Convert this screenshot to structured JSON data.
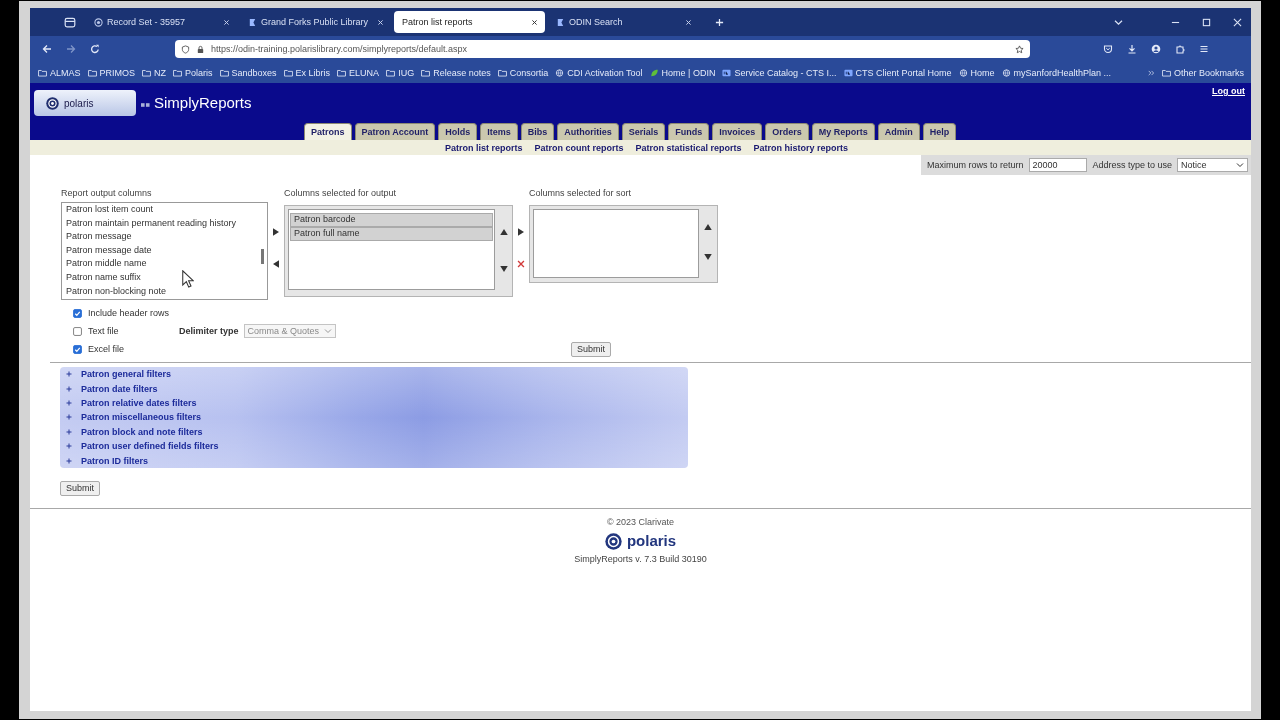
{
  "browser": {
    "tabs": [
      {
        "title": "Record Set - 35957",
        "kind": "dot",
        "selected": false
      },
      {
        "title": "Grand Forks Public Library",
        "kind": "flag",
        "selected": false
      },
      {
        "title": "Patron list reports",
        "kind": "none",
        "selected": true
      },
      {
        "title": "ODIN Search",
        "kind": "flag",
        "selected": false
      }
    ],
    "url": "https://odin-training.polarislibrary.com/simplyreports/default.aspx",
    "bookmarks": [
      {
        "label": "ALMAS",
        "kind": "folder"
      },
      {
        "label": "PRIMOS",
        "kind": "folder"
      },
      {
        "label": "NZ",
        "kind": "folder"
      },
      {
        "label": "Polaris",
        "kind": "folder"
      },
      {
        "label": "Sandboxes",
        "kind": "folder"
      },
      {
        "label": "Ex Libris",
        "kind": "folder"
      },
      {
        "label": "ELUNA",
        "kind": "folder"
      },
      {
        "label": "IUG",
        "kind": "folder"
      },
      {
        "label": "Release notes",
        "kind": "folder"
      },
      {
        "label": "Consortia",
        "kind": "folder"
      },
      {
        "label": "CDI Activation Tool",
        "kind": "globe"
      },
      {
        "label": "Home | ODIN",
        "kind": "leaf"
      },
      {
        "label": "Service Catalog - CTS I...",
        "kind": "tile"
      },
      {
        "label": "CTS Client Portal Home",
        "kind": "tile"
      },
      {
        "label": "Home",
        "kind": "globe"
      },
      {
        "label": "mySanfordHealthPlan ...",
        "kind": "globe"
      }
    ],
    "other_bookmarks": "Other Bookmarks"
  },
  "app": {
    "logo": "polaris",
    "title": "SimplyReports",
    "logout": "Log out",
    "tabs": [
      {
        "label": "Patrons",
        "selected": true
      },
      {
        "label": "Patron Account",
        "selected": false
      },
      {
        "label": "Holds",
        "selected": false
      },
      {
        "label": "Items",
        "selected": false
      },
      {
        "label": "Bibs",
        "selected": false
      },
      {
        "label": "Authorities",
        "selected": false
      },
      {
        "label": "Serials",
        "selected": false
      },
      {
        "label": "Funds",
        "selected": false
      },
      {
        "label": "Invoices",
        "selected": false
      },
      {
        "label": "Orders",
        "selected": false
      },
      {
        "label": "My Reports",
        "selected": false
      },
      {
        "label": "Admin",
        "selected": false
      },
      {
        "label": "Help",
        "selected": false
      }
    ],
    "subtabs": [
      "Patron list reports",
      "Patron count reports",
      "Patron statistical reports",
      "Patron history reports"
    ],
    "max_rows": {
      "label": "Maximum rows to return",
      "value": "20000"
    },
    "address_type": {
      "label": "Address type to use",
      "value": "Notice"
    }
  },
  "columns": {
    "available": {
      "label": "Report output columns",
      "items": [
        "Patron lost item count",
        "Patron maintain permanent reading history",
        "Patron message",
        "Patron message date",
        "Patron middle name",
        "Patron name suffix",
        "Patron non-blocking note"
      ]
    },
    "output": {
      "label": "Columns selected for output",
      "items": [
        {
          "text": "Patron barcode",
          "selected": true
        },
        {
          "text": "Patron full name",
          "selected": true
        }
      ]
    },
    "sort": {
      "label": "Columns selected for sort"
    }
  },
  "file_options": [
    {
      "label": "Include header rows",
      "checked": true
    },
    {
      "label": "Text file",
      "checked": false
    },
    {
      "label": "Excel file",
      "checked": true
    }
  ],
  "delimiter": {
    "label": "Delimiter type",
    "value": "Comma & Quotes",
    "disabled": true
  },
  "submit_top": "Submit",
  "filters": [
    {
      "label": "Patron general filters",
      "expanded": false
    },
    {
      "label": "Patron date filters",
      "expanded": false
    },
    {
      "label": "Patron relative dates filters",
      "expanded": false
    },
    {
      "label": "Patron miscellaneous filters",
      "expanded": false
    },
    {
      "label": "Patron block and note filters",
      "expanded": false
    },
    {
      "label": "Patron user defined fields filters",
      "expanded": false
    },
    {
      "label": "Patron ID filters",
      "expanded": false
    }
  ],
  "submit_bottom": "Submit",
  "footer": {
    "copyright": "© 2023 Clarivate",
    "logo": "polaris",
    "version": "SimplyReports v. 7.3 Build 30190"
  }
}
